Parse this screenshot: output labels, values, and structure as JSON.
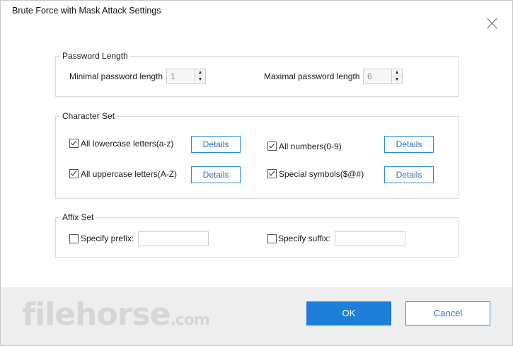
{
  "window": {
    "title": "Brute Force with Mask Attack Settings"
  },
  "password_length": {
    "legend": "Password Length",
    "min_label": "Minimal password length",
    "min_value": "1",
    "max_label": "Maximal password length",
    "max_value": "6"
  },
  "character_set": {
    "legend": "Character Set",
    "details_label": "Details",
    "items": [
      {
        "label": "All lowercase letters(a-z)",
        "checked": true
      },
      {
        "label": "All numbers(0-9)",
        "checked": true
      },
      {
        "label": "All uppercase letters(A-Z)",
        "checked": true
      },
      {
        "label": "Special symbols($@#)",
        "checked": true
      }
    ]
  },
  "affix_set": {
    "legend": "Affix Set",
    "prefix_label": "Specify prefix:",
    "prefix_value": "",
    "suffix_label": "Specify suffix:",
    "suffix_value": ""
  },
  "footer": {
    "ok_label": "OK",
    "cancel_label": "Cancel",
    "watermark": "filehorse",
    "watermark_suffix": ".com"
  },
  "colors": {
    "accent": "#1e7fd8",
    "footer_bg": "#eeeeee"
  }
}
